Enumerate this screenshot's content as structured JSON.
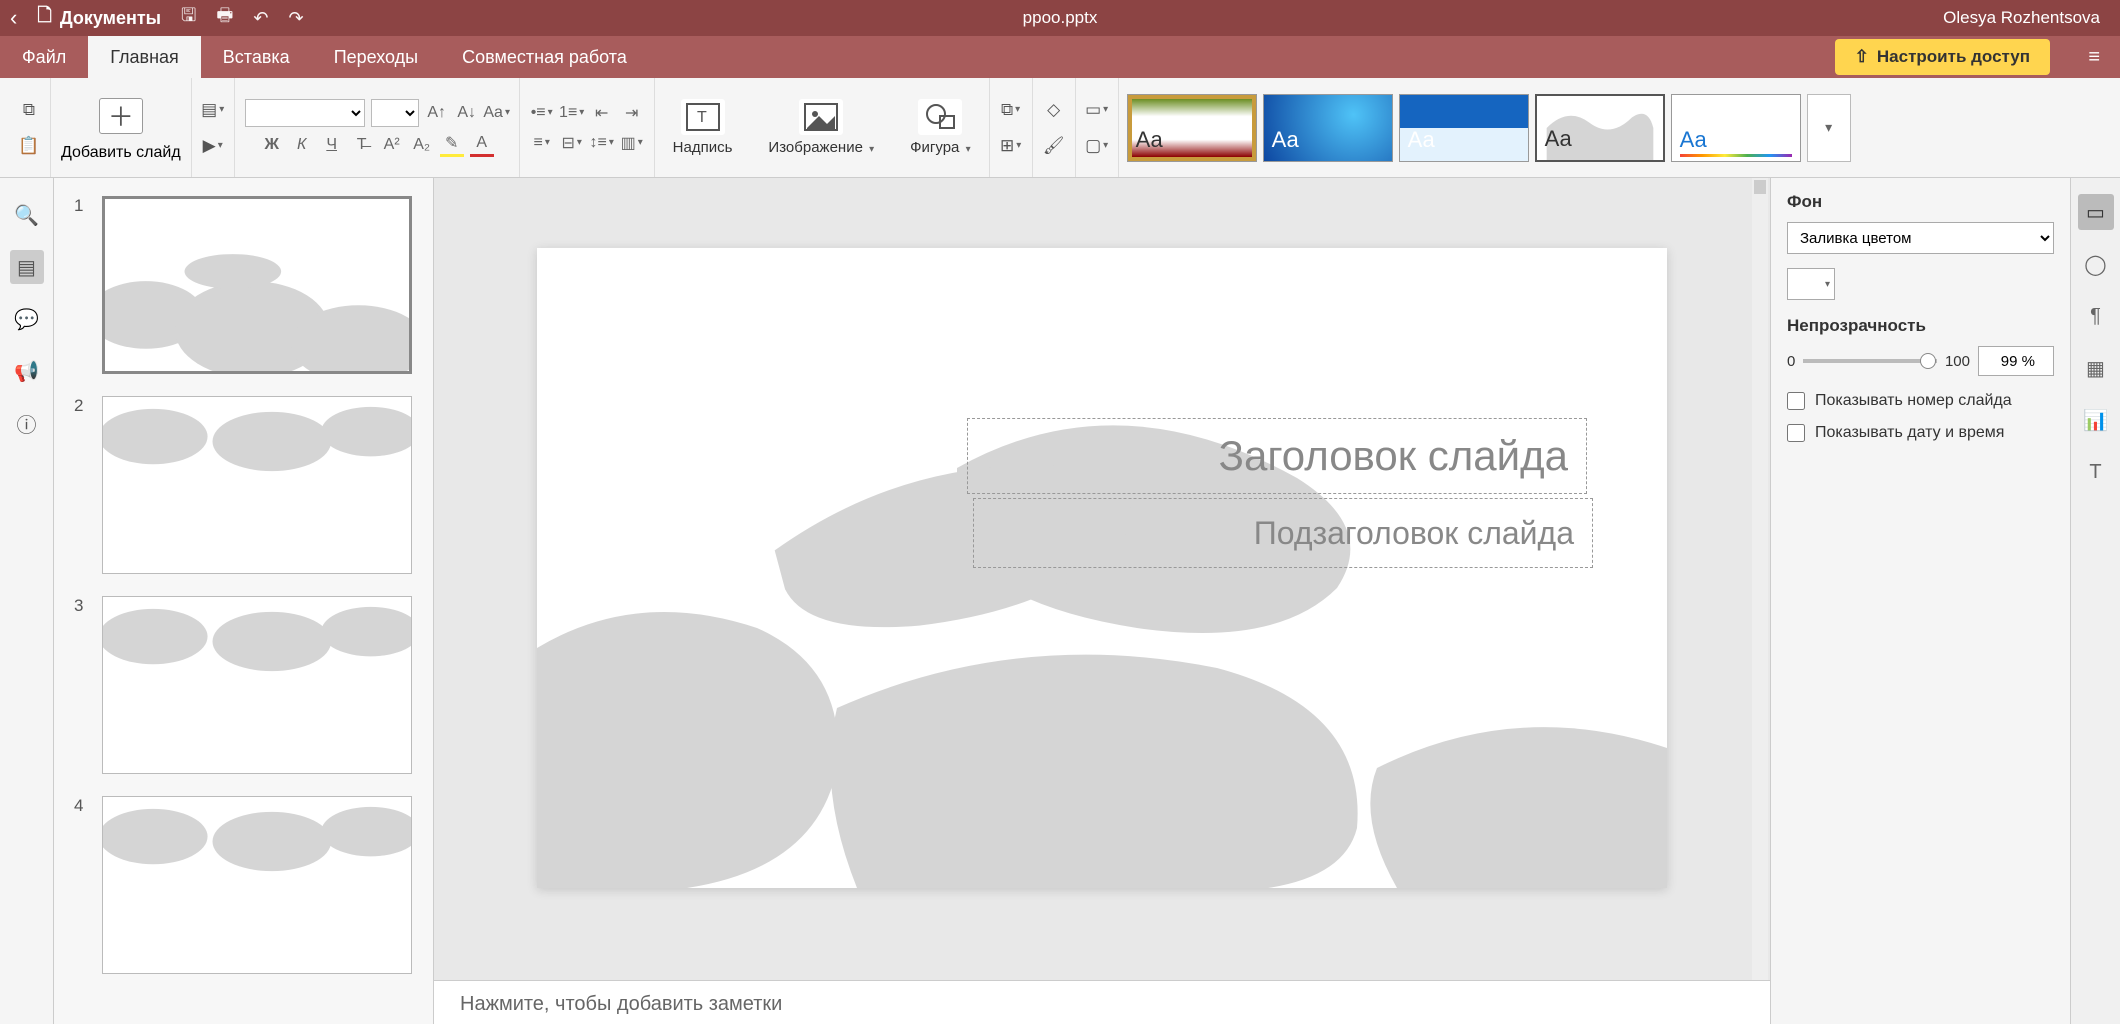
{
  "titlebar": {
    "docs_label": "Документы",
    "filename": "ppoo.pptx",
    "username": "Olesya Rozhentsova"
  },
  "menu": {
    "file": "Файл",
    "home": "Главная",
    "insert": "Вставка",
    "transitions": "Переходы",
    "collab": "Совместная работа",
    "share": "Настроить доступ"
  },
  "ribbon": {
    "add_slide": "Добавить слайд",
    "textbox": "Надпись",
    "image": "Изображение",
    "shape": "Фигура",
    "themes": [
      "Аа",
      "Аа",
      "Аа",
      "Аа",
      "Аа"
    ]
  },
  "slides": {
    "count": 4,
    "numbers": [
      "1",
      "2",
      "3",
      "4"
    ]
  },
  "canvas": {
    "title_placeholder": "Заголовок слайда",
    "subtitle_placeholder": "Подзаголовок слайда"
  },
  "notes": {
    "hint": "Нажмите, чтобы добавить заметки"
  },
  "props": {
    "bg_heading": "Фон",
    "fill_type": "Заливка цветом",
    "opacity_heading": "Непрозрачность",
    "op_min": "0",
    "op_max": "100",
    "op_value": "99 %",
    "show_number": "Показывать номер слайда",
    "show_date": "Показывать дату и время"
  }
}
